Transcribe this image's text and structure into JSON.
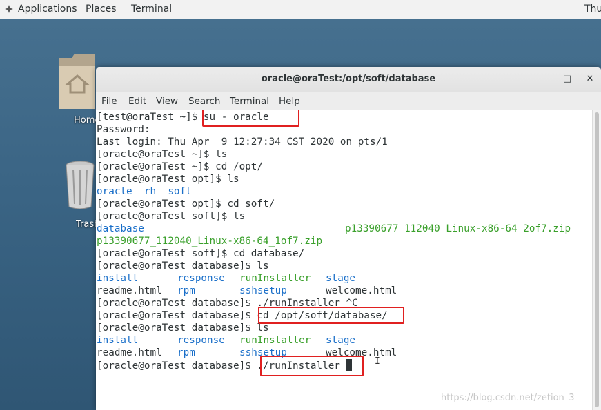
{
  "topbar": {
    "applications": "Applications",
    "places": "Places",
    "terminal": "Terminal",
    "clock": "Thu"
  },
  "desktop": {
    "home_label": "Home",
    "trash_label": "Trash"
  },
  "window": {
    "title": "oracle@oraTest:/opt/soft/database",
    "minimize": "–",
    "maximize": "□",
    "close": "✕"
  },
  "menu": [
    "File",
    "Edit",
    "View",
    "Search",
    "Terminal",
    "Help"
  ],
  "terminal": {
    "lines": [
      "[test@oraTest ~]$ su - oracle",
      "Password:",
      "Last login: Thu Apr  9 12:27:34 CST 2020 on pts/1",
      "[oracle@oraTest ~]$ ls",
      "[oracle@oraTest ~]$ cd /opt/",
      "[oracle@oraTest opt]$ ls",
      "[oracle@oraTest opt]$ cd soft/",
      "[oracle@oraTest soft]$ ls",
      "[oracle@oraTest soft]$ cd database/",
      "[oracle@oraTest database]$ ls",
      "readme.html",
      "[oracle@oraTest database]$ ./runInstaller ^C",
      "[oracle@oraTest database]$ cd /opt/soft/database/",
      "[oracle@oraTest database]$ ls",
      "readme.html",
      "[oracle@oraTest database]$ ./runInstaller "
    ],
    "ls_opt": [
      "oracle",
      "rh",
      "soft"
    ],
    "ls_soft": [
      "database",
      "p13390677_112040_Linux-x86-64_2of7.zip",
      "p13390677_112040_Linux-x86-64_1of7.zip"
    ],
    "ls_db_dirs": [
      "install",
      "response",
      "runInstaller",
      "stage"
    ],
    "ls_db_files": [
      "rpm",
      "sshsetup",
      "welcome.html"
    ]
  },
  "watermark": "https://blog.csdn.net/zetion_3",
  "colors": {
    "highlight": "#e02020",
    "dir_blue": "#1a6fc9",
    "exec_green": "#3aa02b"
  }
}
